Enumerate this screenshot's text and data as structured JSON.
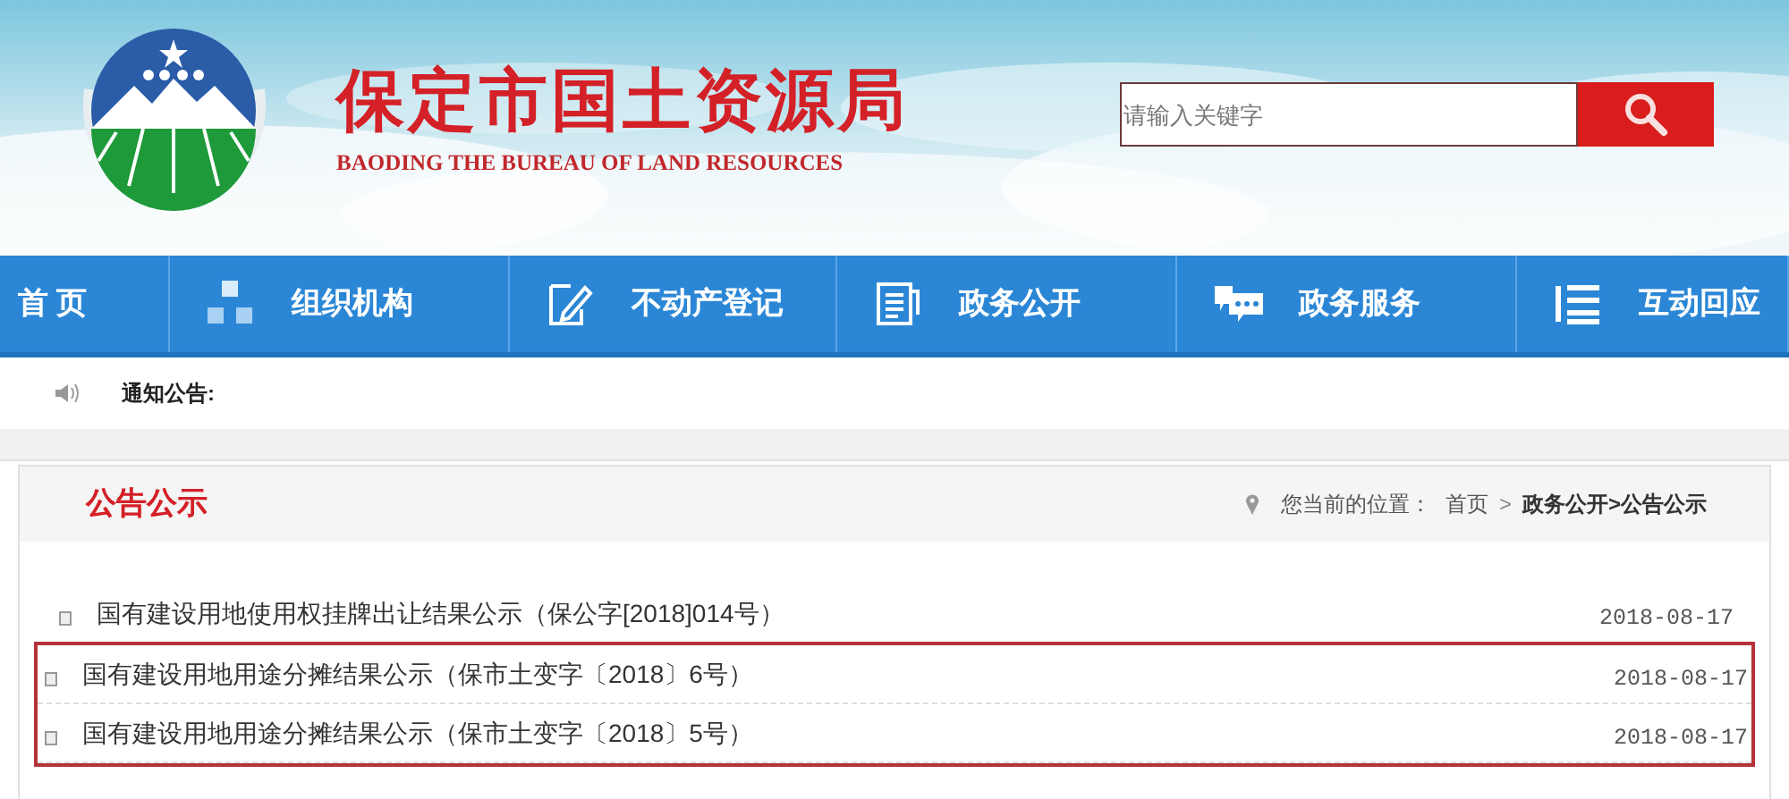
{
  "header": {
    "title": "保定市国土资源局",
    "subtitle": "BAODING THE BUREAU OF LAND RESOURCES",
    "search": {
      "placeholder": "请输入关键字"
    }
  },
  "nav": [
    {
      "label": "首 页",
      "kind": "plain"
    },
    {
      "label": "组织机构",
      "kind": "org"
    },
    {
      "label": "不动产登记",
      "kind": "edit"
    },
    {
      "label": "政务公开",
      "kind": "doc"
    },
    {
      "label": "政务服务",
      "kind": "chat"
    },
    {
      "label": "互动回应",
      "kind": "list"
    }
  ],
  "notice": {
    "label": "通知公告:"
  },
  "panel": {
    "title": "公告公示",
    "breadcrumb": {
      "label": "您当前的位置：",
      "separator": ">",
      "items": [
        "首页",
        "政务公开>公告公示"
      ]
    },
    "rows": [
      {
        "title": "国有建设用地使用权挂牌出让结果公示（保公字[2018]014号）",
        "date": "2018-08-17",
        "highlighted": false
      },
      {
        "title": "国有建设用地用途分摊结果公示（保市土变字〔2018〕6号）",
        "date": "2018-08-17",
        "highlighted": true
      },
      {
        "title": "国有建设用地用途分摊结果公示（保市土变字〔2018〕5号）",
        "date": "2018-08-17",
        "highlighted": true
      }
    ]
  }
}
